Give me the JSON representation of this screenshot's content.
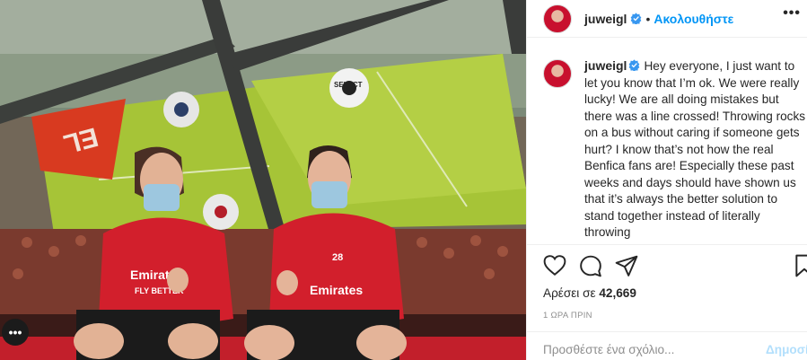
{
  "post": {
    "username": "juweigl",
    "follow_label": "Ακολουθήστε",
    "separator": "•",
    "more_label": "•••",
    "caption": "Hey everyone, I just want to let you know that I’m ok. We were really lucky! We are all doing mistakes but there was a line crossed! Throwing rocks on a bus without caring if someone gets hurt? I know that’s not how the real Benfica fans are! Especially these past weeks and days should have shown us that it’s always the better solution to stand together instead of literally throwing",
    "likes_prefix": "Αρέσει σε ",
    "likes_count": "42,669",
    "timestamp": "1 ΩΡΑ ΠΡΙΝ",
    "comment_placeholder": "Προσθέστε ένα σχόλιο...",
    "post_label": "Δημοσίευση"
  },
  "photo": {
    "left_banner_text": "EL",
    "shirt_sponsor": "Emirates",
    "shirt_sponsor_sub": "FLY BETTER",
    "ball_text": "SELECT",
    "player_number": "28",
    "more_dots": "•••"
  },
  "colors": {
    "accent": "#0095f6",
    "benfica_red": "#c8102e",
    "pitch": "#9fc23a",
    "muted": "#8e8e8e"
  },
  "icons": [
    "verified-badge-icon",
    "heart-icon",
    "comment-icon",
    "share-icon",
    "bookmark-icon",
    "more-options-icon"
  ]
}
